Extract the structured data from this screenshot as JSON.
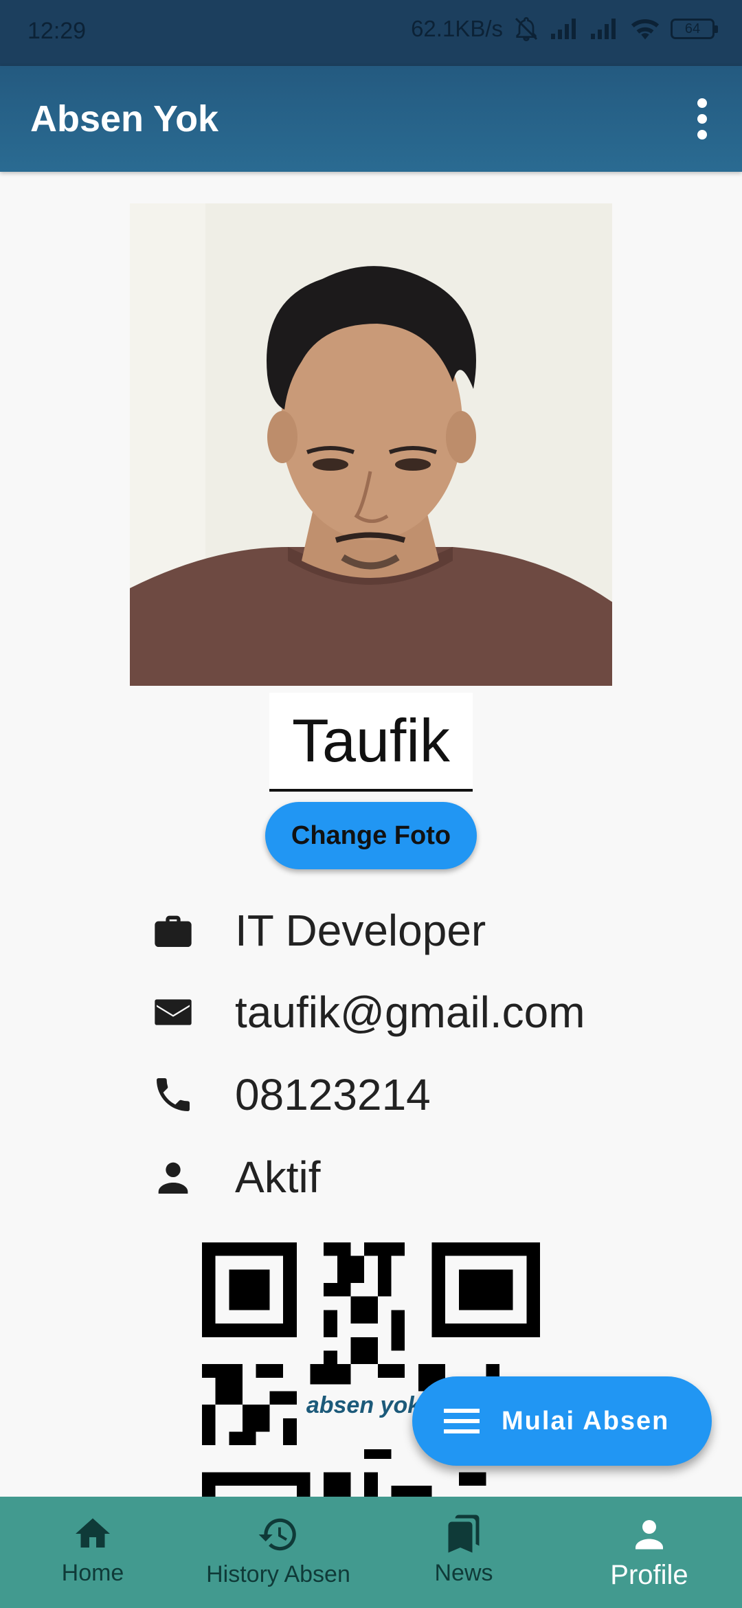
{
  "status_bar": {
    "time": "12:29",
    "network_speed": "62.1KB/s",
    "battery": "64",
    "icons": [
      "mute-bell-icon",
      "signal-icon",
      "signal-icon",
      "wifi-icon",
      "battery-icon"
    ]
  },
  "app_bar": {
    "title": "Absen Yok",
    "menu_icon": "more-vert-icon"
  },
  "profile": {
    "name": "Taufik",
    "change_photo_label": "Change Foto",
    "details": [
      {
        "icon": "briefcase-icon",
        "value": "IT Developer"
      },
      {
        "icon": "mail-icon",
        "value": "taufik@gmail.com"
      },
      {
        "icon": "phone-icon",
        "value": "08123214"
      },
      {
        "icon": "person-icon",
        "value": "Aktif"
      }
    ],
    "qr_logo_text": "absen yok"
  },
  "fab": {
    "label": "Mulai Absen",
    "icon": "menu-icon"
  },
  "bottom_nav": {
    "items": [
      {
        "label": "Home",
        "icon": "home-icon"
      },
      {
        "label": "History Absen",
        "icon": "history-icon"
      },
      {
        "label": "News",
        "icon": "bookmarks-icon"
      },
      {
        "label": "Profile",
        "icon": "person-icon",
        "active": true
      }
    ]
  },
  "colors": {
    "app_bar": "#2a6b92",
    "status_bar": "#1c3f5e",
    "primary_button": "#2196f3",
    "bottom_nav": "#429a8f"
  }
}
